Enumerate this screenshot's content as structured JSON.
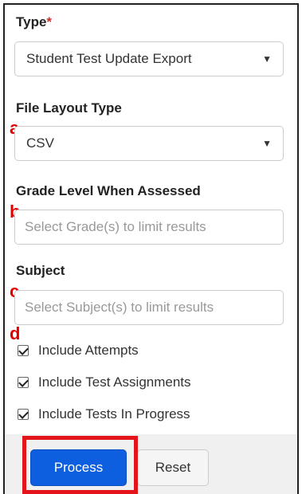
{
  "type_field": {
    "label": "Type",
    "required_mark": "*",
    "value": "Student Test Update Export"
  },
  "file_layout": {
    "label": "File Layout Type",
    "marker": "a",
    "value": "CSV"
  },
  "grade": {
    "label": "Grade Level When Assessed",
    "marker": "b",
    "placeholder": "Select Grade(s) to limit results"
  },
  "subject": {
    "label": "Subject",
    "marker": "c",
    "placeholder": "Select Subject(s) to limit results"
  },
  "options": {
    "marker": "d",
    "items": [
      {
        "label": "Include Attempts",
        "checked": true
      },
      {
        "label": "Include Test Assignments",
        "checked": true
      },
      {
        "label": "Include Tests In Progress",
        "checked": true
      }
    ]
  },
  "buttons": {
    "process": "Process",
    "reset": "Reset"
  },
  "colors": {
    "primary": "#0d5fe0",
    "highlight": "#e4141b",
    "marker": "#e00000"
  },
  "icons": {
    "dropdown": "caret-down-icon",
    "checkbox": "checkbox-checked-icon"
  }
}
